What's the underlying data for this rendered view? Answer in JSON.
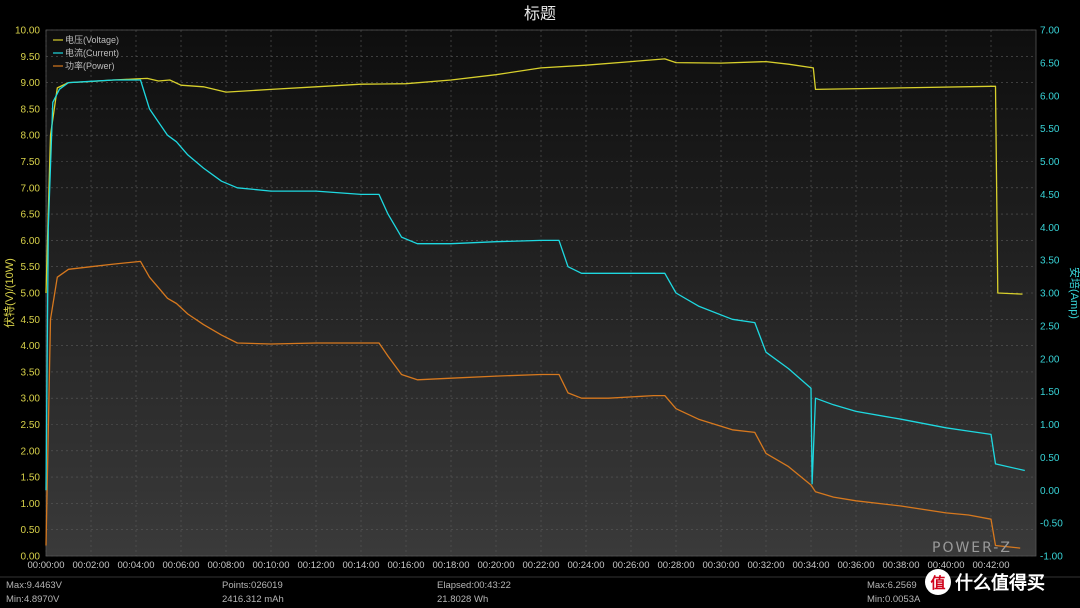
{
  "title": "标题",
  "stats": {
    "max_voltage": "Max:9.4463V",
    "min_voltage": "Min:4.8970V",
    "points": "Points:026019",
    "capacity": "2416.312 mAh",
    "elapsed": "Elapsed:00:43:22",
    "energy": "21.8028 Wh",
    "max_current": "Max:6.2569",
    "min_current": "Min:0.0053A"
  },
  "brand": {
    "watermark": "POWER-Z",
    "site_logo": "什么值得买"
  },
  "colors": {
    "voltage": "#d8d02c",
    "current": "#1ed8e0",
    "power": "#d6781e",
    "background_top": "#0e0e0e",
    "background_bottom": "#3a3a3a",
    "grid": "#5a5a5a"
  },
  "chart_data": {
    "type": "line",
    "title": "标题",
    "xlabel": "",
    "ylabel_left": "伏特(V)/(10W)",
    "ylabel_right": "安培(Amp)",
    "x_unit": "minutes",
    "xlim": [
      0,
      44
    ],
    "ylim_left": [
      0,
      10
    ],
    "ylim_right": [
      -1,
      7
    ],
    "grid": true,
    "legend_position": "top-left",
    "x_ticks": [
      "00:00:00",
      "00:02:00",
      "00:04:00",
      "00:06:00",
      "00:08:00",
      "00:10:00",
      "00:12:00",
      "00:14:00",
      "00:16:00",
      "00:18:00",
      "00:20:00",
      "00:22:00",
      "00:24:00",
      "00:26:00",
      "00:28:00",
      "00:30:00",
      "00:32:00",
      "00:34:00",
      "00:36:00",
      "00:38:00",
      "00:40:00",
      "00:42:00"
    ],
    "y_ticks_left": [
      "0.00",
      "0.50",
      "1.00",
      "1.50",
      "2.00",
      "2.50",
      "3.00",
      "3.50",
      "4.00",
      "4.50",
      "5.00",
      "5.50",
      "6.00",
      "6.50",
      "7.00",
      "7.50",
      "8.00",
      "8.50",
      "9.00",
      "9.50",
      "10.00"
    ],
    "y_ticks_right": [
      "-1.00",
      "-0.50",
      "0.00",
      "0.50",
      "1.00",
      "1.50",
      "2.00",
      "2.50",
      "3.00",
      "3.50",
      "4.00",
      "4.50",
      "5.00",
      "5.50",
      "6.00",
      "6.50",
      "7.00"
    ],
    "series": [
      {
        "name": "电压(Voltage)",
        "axis": "left",
        "x": [
          0,
          0.2,
          0.5,
          1,
          2,
          3,
          4,
          4.5,
          5,
          5.5,
          6,
          7,
          8,
          10,
          12,
          14,
          16,
          18,
          20,
          22,
          24,
          26,
          27.5,
          28,
          30,
          32,
          33,
          34.1,
          34.2,
          38,
          42,
          42.2,
          42.3,
          43.4
        ],
        "y": [
          5.0,
          8.0,
          8.9,
          9.0,
          9.02,
          9.05,
          9.07,
          9.08,
          9.03,
          9.05,
          8.95,
          8.92,
          8.82,
          8.87,
          8.92,
          8.97,
          8.98,
          9.05,
          9.15,
          9.28,
          9.33,
          9.4,
          9.45,
          9.38,
          9.37,
          9.4,
          9.35,
          9.28,
          8.87,
          8.9,
          8.93,
          8.93,
          5.0,
          4.98
        ]
      },
      {
        "name": "电流(Current)",
        "axis": "right",
        "x": [
          0,
          0.1,
          0.3,
          0.6,
          1,
          2,
          3,
          4.2,
          4.6,
          5.0,
          5.4,
          5.8,
          6.3,
          7,
          7.8,
          8.5,
          10,
          12,
          14,
          14.8,
          15.2,
          15.8,
          16.5,
          18,
          20,
          22,
          22.8,
          23.2,
          23.8,
          25,
          27,
          27.5,
          28,
          29,
          30.5,
          31.5,
          32,
          33,
          34,
          34.05,
          34.2,
          35,
          36,
          38,
          40,
          41,
          42,
          42.2,
          43.5
        ],
        "y": [
          0.0,
          4.0,
          5.9,
          6.1,
          6.2,
          6.22,
          6.24,
          6.24,
          5.8,
          5.6,
          5.4,
          5.3,
          5.1,
          4.9,
          4.7,
          4.6,
          4.55,
          4.55,
          4.5,
          4.5,
          4.2,
          3.85,
          3.75,
          3.75,
          3.78,
          3.8,
          3.8,
          3.4,
          3.3,
          3.3,
          3.3,
          3.3,
          3.0,
          2.8,
          2.6,
          2.55,
          2.1,
          1.85,
          1.55,
          0.1,
          1.4,
          1.3,
          1.2,
          1.08,
          0.95,
          0.9,
          0.85,
          0.4,
          0.3
        ]
      },
      {
        "name": "功率(Power)",
        "axis": "left",
        "x": [
          0,
          0.2,
          0.5,
          1,
          2,
          3,
          4.2,
          4.6,
          5.0,
          5.4,
          5.8,
          6.3,
          7,
          7.8,
          8.5,
          10,
          12,
          14,
          14.8,
          15.2,
          15.8,
          16.5,
          18,
          20,
          22,
          22.8,
          23.2,
          23.8,
          25,
          27,
          27.5,
          28,
          29,
          30.5,
          31.5,
          32,
          33,
          34,
          34.2,
          35,
          36,
          38,
          40,
          41,
          42,
          42.2,
          43.3
        ],
        "y": [
          0.2,
          4.5,
          5.3,
          5.45,
          5.5,
          5.55,
          5.6,
          5.3,
          5.1,
          4.9,
          4.8,
          4.6,
          4.4,
          4.2,
          4.05,
          4.03,
          4.05,
          4.05,
          4.05,
          3.8,
          3.45,
          3.35,
          3.38,
          3.42,
          3.45,
          3.45,
          3.1,
          3.0,
          3.0,
          3.05,
          3.05,
          2.8,
          2.6,
          2.4,
          2.35,
          1.95,
          1.7,
          1.35,
          1.22,
          1.12,
          1.05,
          0.95,
          0.82,
          0.78,
          0.7,
          0.2,
          0.15
        ]
      }
    ]
  }
}
